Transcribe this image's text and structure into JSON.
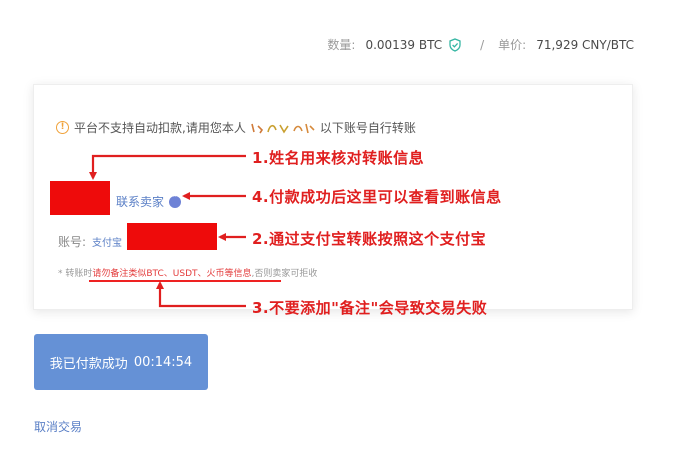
{
  "header": {
    "quantity_label": "数量:",
    "quantity_value": "0.00139 BTC",
    "separator": "/",
    "price_label": "单价:",
    "price_value": "71,929 CNY/BTC"
  },
  "card": {
    "notice_prefix": "平台不支持自动扣款,请用您本人",
    "notice_suffix": "以下账号自行转账",
    "seller_link": "联系卖家",
    "account_label": "账号:",
    "account_type": "支付宝",
    "note_prefix": "* 转账时",
    "note_highlight": "请勿备注类似BTC、USDT、火币等信息",
    "note_suffix": ",否则卖家可拒收"
  },
  "annotations": {
    "a1": "1.姓名用来核对转账信息",
    "a4": "4.付款成功后这里可以查看到账信息",
    "a2": "2.通过支付宝转账按照这个支付宝",
    "a3": "3.不要添加\"备注\"会导致交易失败"
  },
  "actions": {
    "pay_button": "我已付款成功",
    "timer": "00:14:54",
    "cancel": "取消交易"
  },
  "colors": {
    "annotation_red": "#e01f1f",
    "redact_red": "#ee0b0b",
    "link_blue": "#5a7fc6",
    "button_blue": "#6591d6",
    "warn_orange": "#f0a23a"
  }
}
